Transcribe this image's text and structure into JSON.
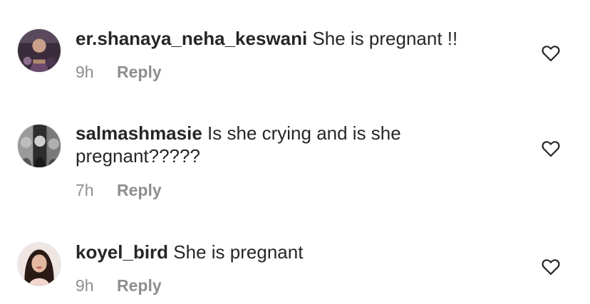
{
  "comments": [
    {
      "username": "er.shanaya_neha_keswani",
      "text": "She is pregnant !!",
      "time": "9h",
      "reply_label": "Reply",
      "icon": "heart-outline-icon"
    },
    {
      "username": "salmashmasie",
      "text": "Is she crying and is she pregnant?????",
      "time": "7h",
      "reply_label": "Reply",
      "icon": "heart-outline-icon"
    },
    {
      "username": "koyel_bird",
      "text": "She is pregnant",
      "time": "9h",
      "reply_label": "Reply",
      "icon": "heart-outline-icon"
    }
  ],
  "colors": {
    "text": "#262626",
    "secondary": "#8e8e8e",
    "background": "#ffffff"
  }
}
